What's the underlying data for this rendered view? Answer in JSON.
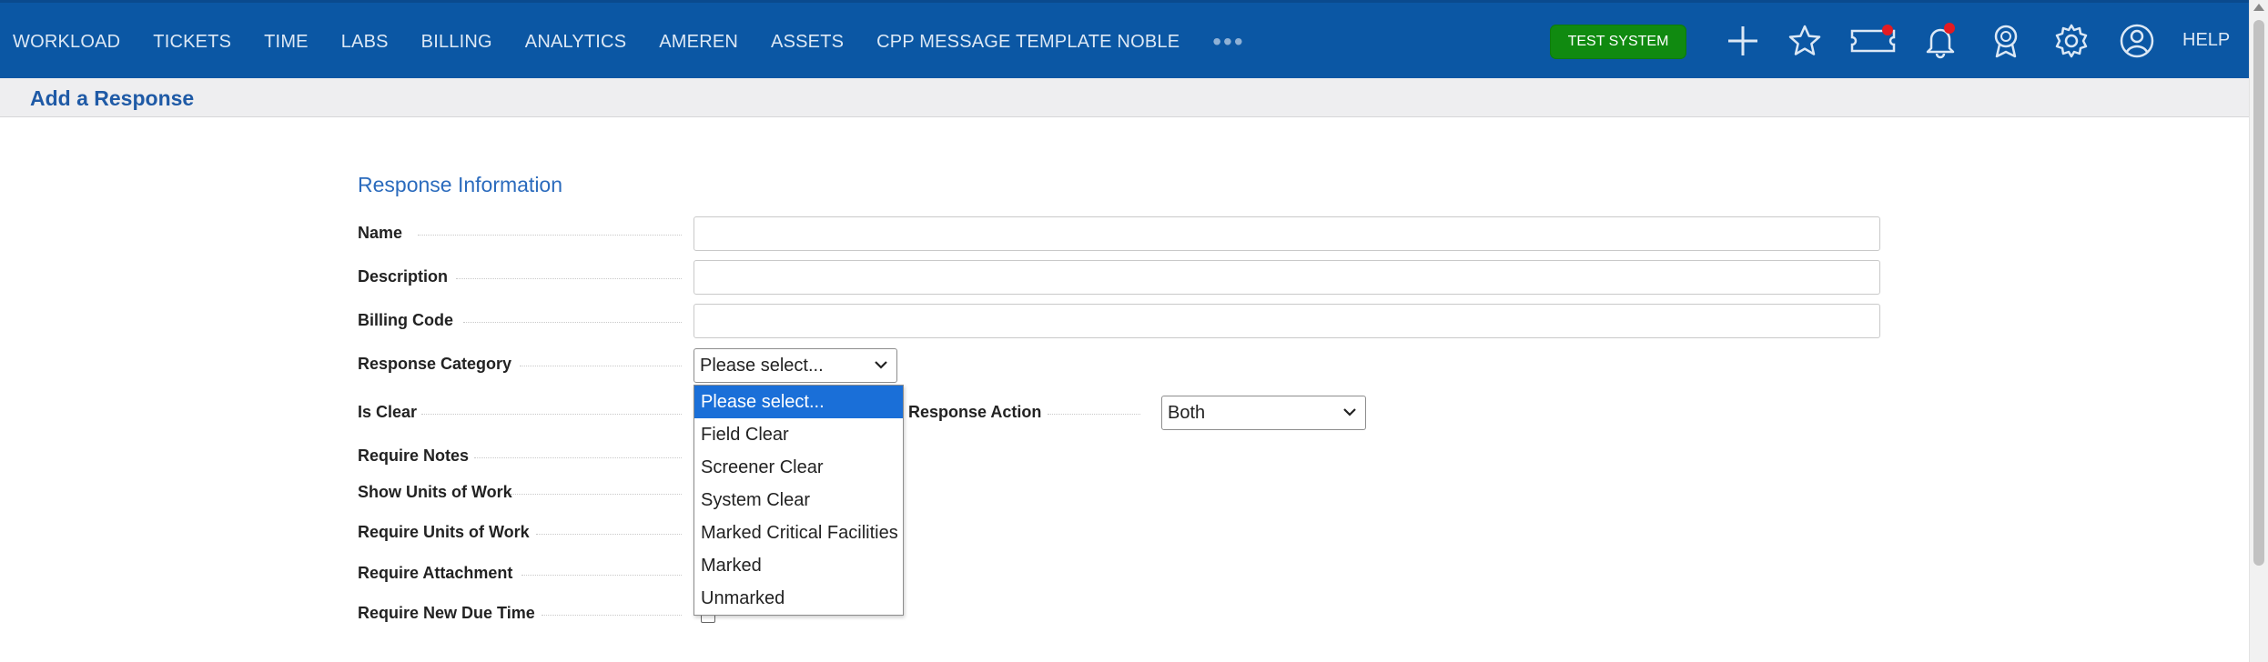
{
  "nav": {
    "items": [
      "WORKLOAD",
      "TICKETS",
      "TIME",
      "LABS",
      "BILLING",
      "ANALYTICS",
      "AMEREN",
      "ASSETS",
      "CPP MESSAGE TEMPLATE NOBLE"
    ],
    "more": "•••",
    "badge": "TEST SYSTEM",
    "help": "HELP",
    "icons": [
      "plus-icon",
      "star-icon",
      "ticket-icon",
      "bell-icon",
      "award-icon",
      "gear-icon",
      "user-icon"
    ],
    "notification_color": "#e31b23"
  },
  "header": {
    "title": "Add a Response"
  },
  "form": {
    "section_title": "Response Information",
    "labels": {
      "name": "Name",
      "description": "Description",
      "billing_code": "Billing Code",
      "response_category": "Response Category",
      "is_clear": "Is Clear",
      "response_action": "e Response Action",
      "require_notes": "Require Notes",
      "show_units": "Show Units of Work",
      "require_units": "Require Units of Work",
      "require_attachment": "Require Attachment",
      "require_due_time": "Require New Due Time"
    },
    "values": {
      "name": "",
      "description": "",
      "billing_code": ""
    },
    "response_category_selected": "Please select...",
    "response_action_selected": "Both",
    "category_options": [
      "Please select...",
      "Field Clear",
      "Screener Clear",
      "System Clear",
      "Marked Critical Facilities",
      "Marked",
      "Unmarked"
    ]
  },
  "colors": {
    "topbar": "#0b57a4",
    "badge": "#108a10",
    "accent": "#1f5aa6",
    "highlight": "#1a6fd8"
  }
}
